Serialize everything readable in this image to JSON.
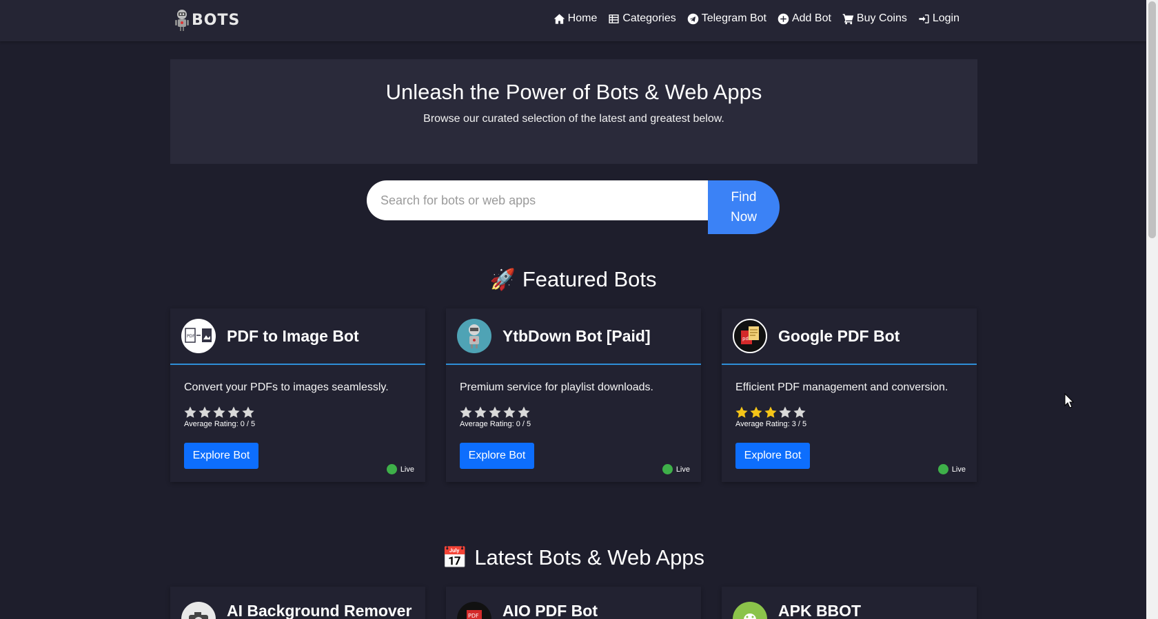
{
  "navbar": {
    "logo_text": "BOTS",
    "links": [
      {
        "label": "Home",
        "icon": "home-icon"
      },
      {
        "label": "Categories",
        "icon": "table-icon"
      },
      {
        "label": "Telegram Bot",
        "icon": "telegram-icon"
      },
      {
        "label": "Add Bot",
        "icon": "plus-circle-icon"
      },
      {
        "label": "Buy Coins",
        "icon": "cart-icon"
      },
      {
        "label": "Login",
        "icon": "login-icon"
      }
    ]
  },
  "hero": {
    "title": "Unleash the Power of Bots & Web Apps",
    "subtitle": "Browse our curated selection of the latest and greatest below."
  },
  "search": {
    "placeholder": "Search for bots or web apps",
    "value": "",
    "button_label": "Find Now"
  },
  "featured": {
    "emoji": "🚀",
    "title": "Featured Bots",
    "cards": [
      {
        "title": "PDF to Image Bot",
        "description": "Convert your PDFs to images seamlessly.",
        "rating": 0,
        "rating_text": "Average Rating: 0 / 5",
        "button_label": "Explore Bot",
        "status": "Live",
        "avatar_icon": "pdf-to-image-icon"
      },
      {
        "title": "YtbDown Bot [Paid]",
        "description": "Premium service for playlist downloads.",
        "rating": 0,
        "rating_text": "Average Rating: 0 / 5",
        "button_label": "Explore Bot",
        "status": "Live",
        "avatar_icon": "robot-icon"
      },
      {
        "title": "Google PDF Bot",
        "description": "Efficient PDF management and conversion.",
        "rating": 3,
        "rating_text": "Average Rating: 3 / 5",
        "button_label": "Explore Bot",
        "status": "Live",
        "avatar_icon": "pdf-document-icon"
      }
    ]
  },
  "latest": {
    "emoji": "📅",
    "title": "Latest Bots & Web Apps",
    "cards": [
      {
        "title": "AI Background Remover",
        "avatar_icon": "camera-icon"
      },
      {
        "title": "AIO PDF Bot",
        "avatar_icon": "pdf-icon"
      },
      {
        "title": "APK BBOT",
        "avatar_icon": "android-icon"
      }
    ]
  },
  "colors": {
    "background": "#1e1e2c",
    "navbar": "#252534",
    "accent": "#0d6efd",
    "card_divider": "#2f8fd8",
    "star_filled": "#f5c518",
    "star_empty": "#d9d9d9",
    "live": "#3eb049"
  }
}
